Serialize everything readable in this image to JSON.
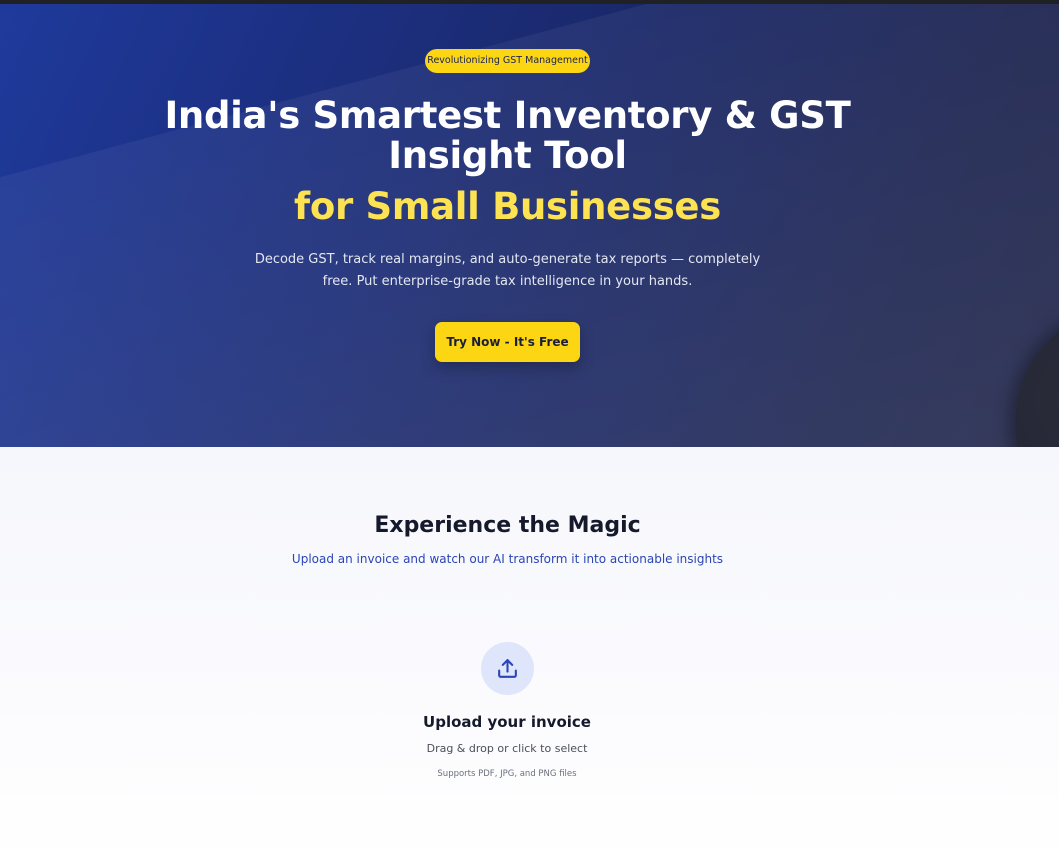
{
  "hero": {
    "badge": "Revolutionizing GST Management",
    "title_line1": "India's Smartest Inventory & GST Insight Tool",
    "title_line2": "for Small Businesses",
    "description": "Decode GST, track real margins, and auto-generate tax reports — completely free. Put enterprise-grade tax intelligence in your hands.",
    "cta_label": "Try Now - It's Free"
  },
  "demo": {
    "title": "Experience the Magic",
    "subtitle": "Upload an invoice and watch our AI transform it into actionable insights"
  },
  "upload": {
    "icon": "upload-icon",
    "title": "Upload your invoice",
    "hint": "Drag & drop or click to select",
    "formats": "Supports PDF, JPG, and PNG files"
  },
  "colors": {
    "accent_yellow": "#fcd513",
    "heading_yellow": "#fde252",
    "hero_blue": "#1f3a9c",
    "link_blue": "#2b45b6"
  }
}
